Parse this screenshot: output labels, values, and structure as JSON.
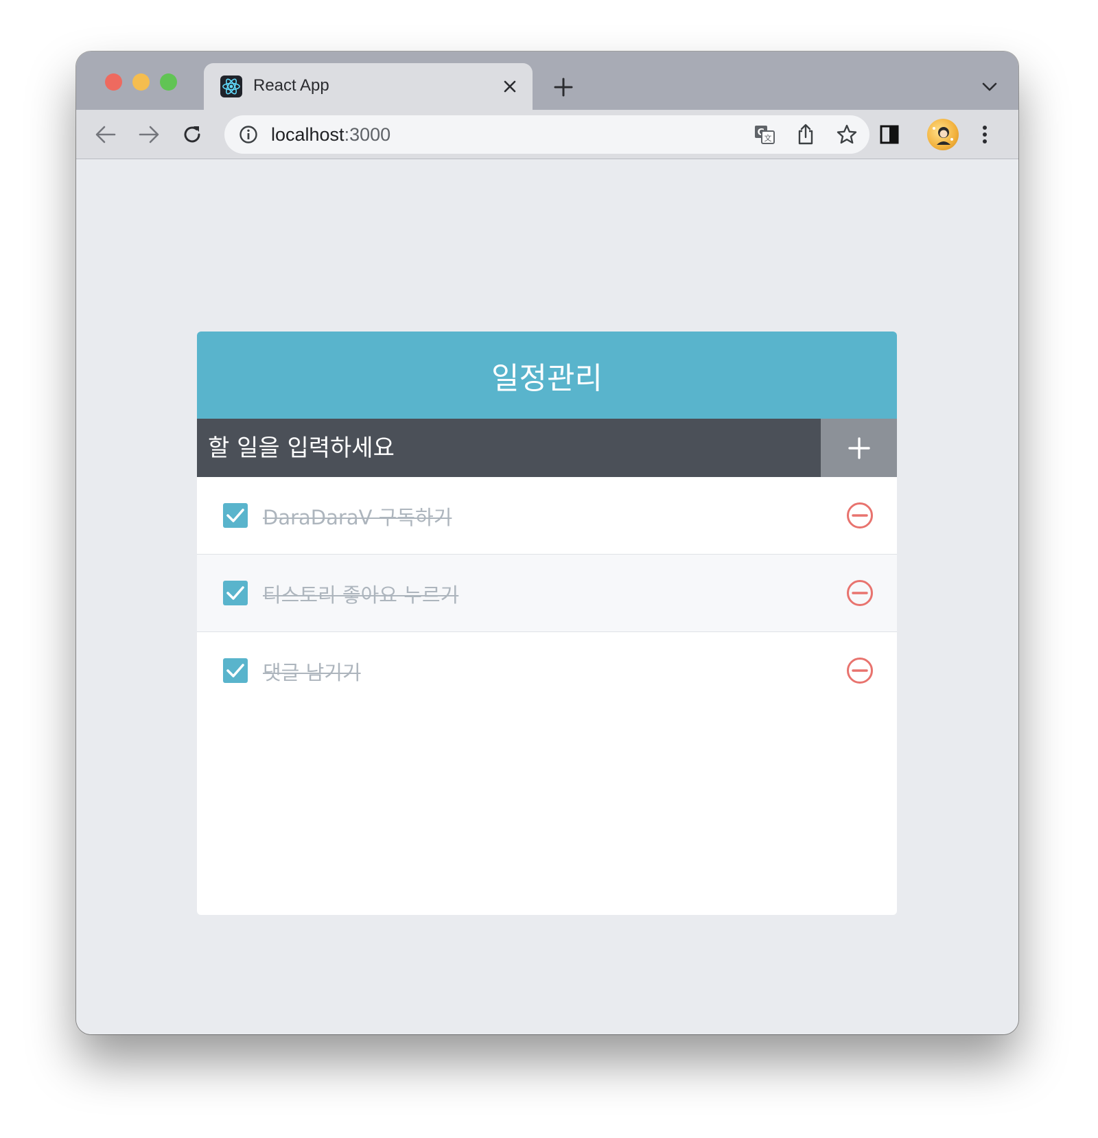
{
  "browser": {
    "tab_title": "React App",
    "url_host": "localhost",
    "url_port": ":3000",
    "favicon": "react-logo-icon",
    "accent_colors": {
      "close": "#ee6a5f",
      "minimize": "#f5bd4f",
      "maximize": "#61c454"
    }
  },
  "app": {
    "title": "일정관리",
    "input_placeholder": "할 일을 입력하세요",
    "add_icon": "plus-icon",
    "colors": {
      "header": "#59b4cc",
      "input_bar": "#4b5058",
      "add_button": "#8c9198",
      "checkbox": "#59b4cc",
      "remove": "#e8736e",
      "done_text": "#adb5bd"
    },
    "todos": [
      {
        "text": "DaraDaraV 구독하기",
        "checked": true
      },
      {
        "text": "티스토리 좋아요 누르기",
        "checked": true
      },
      {
        "text": "댓글 남기기",
        "checked": true
      }
    ]
  }
}
